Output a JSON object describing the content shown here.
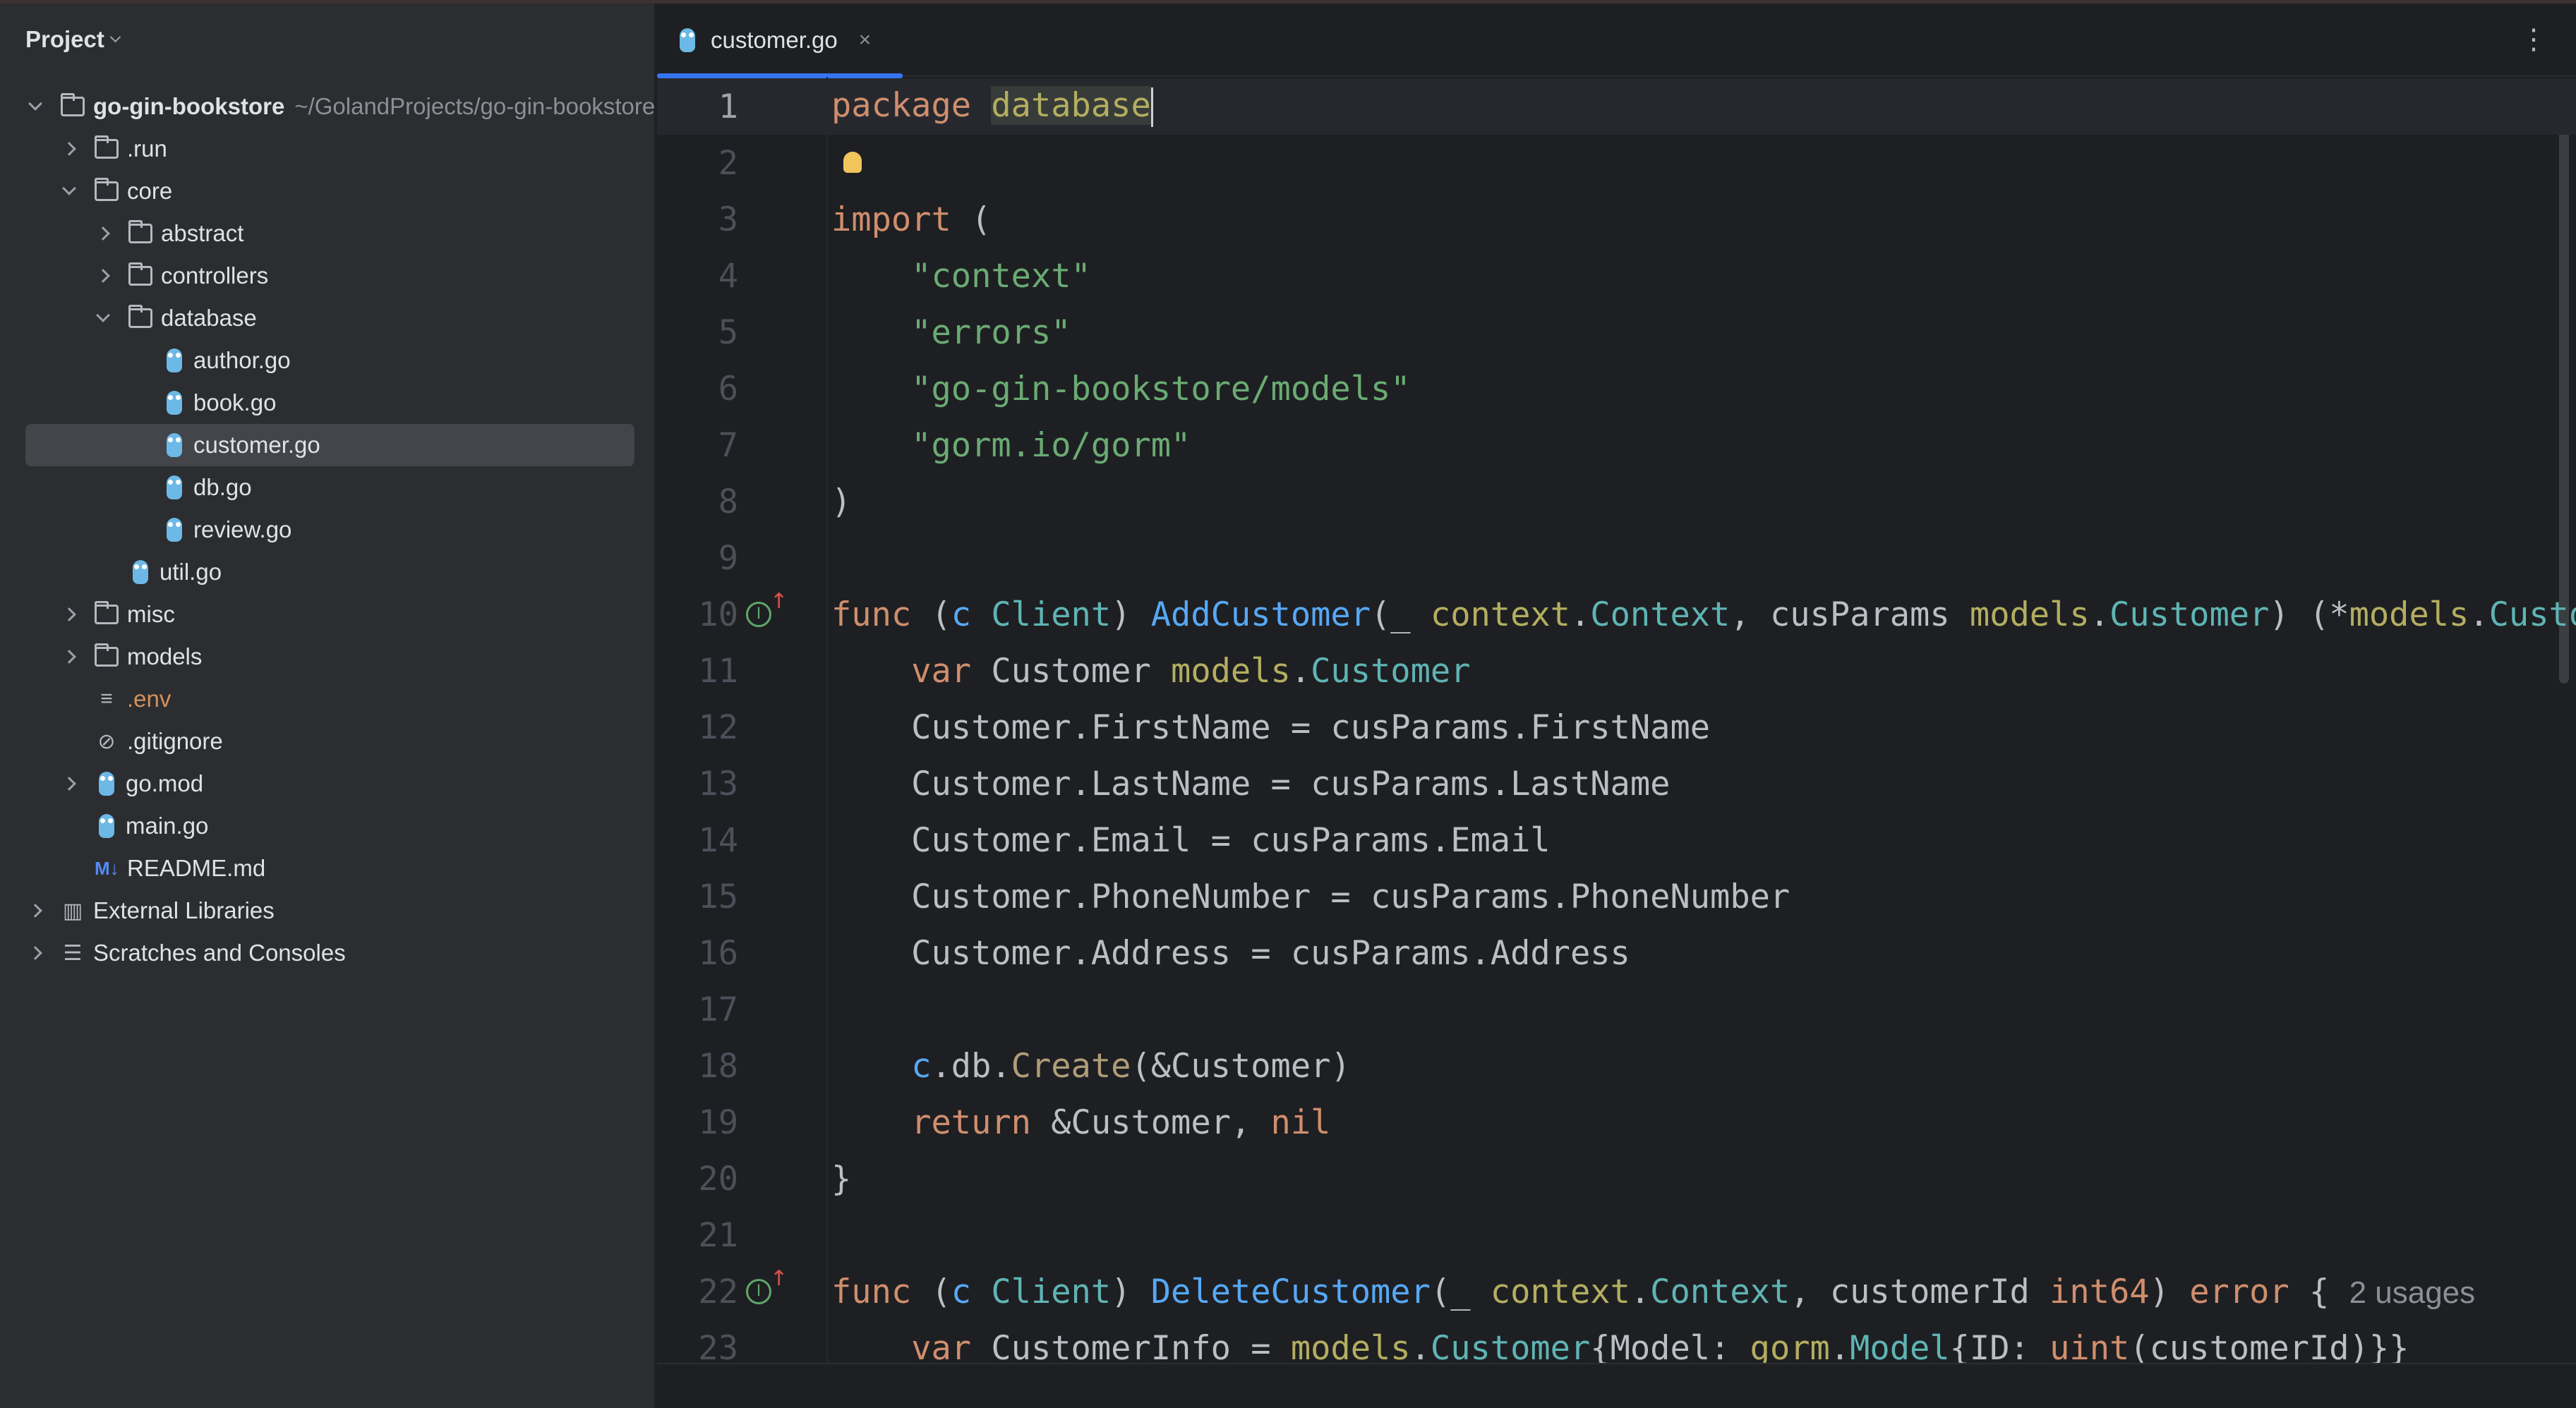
{
  "sidebar": {
    "title": "Project",
    "tree": [
      {
        "label": "go-gin-bookstore",
        "path": "~/GolandProjects/go-gin-bookstore",
        "level": 0,
        "icon": "folder-icon",
        "state": "open",
        "bold": true
      },
      {
        "label": ".run",
        "level": 1,
        "icon": "folder-icon",
        "state": "closed"
      },
      {
        "label": "core",
        "level": 1,
        "icon": "folder-icon",
        "state": "open"
      },
      {
        "label": "abstract",
        "level": 2,
        "icon": "folder-icon",
        "state": "closed"
      },
      {
        "label": "controllers",
        "level": 2,
        "icon": "folder-icon",
        "state": "closed"
      },
      {
        "label": "database",
        "level": 2,
        "icon": "folder-icon",
        "state": "open"
      },
      {
        "label": "author.go",
        "level": 3,
        "icon": "gopher-icon"
      },
      {
        "label": "book.go",
        "level": 3,
        "icon": "gopher-icon"
      },
      {
        "label": "customer.go",
        "level": 3,
        "icon": "gopher-icon",
        "selected": true
      },
      {
        "label": "db.go",
        "level": 3,
        "icon": "gopher-icon"
      },
      {
        "label": "review.go",
        "level": 3,
        "icon": "gopher-icon"
      },
      {
        "label": "util.go",
        "level": 2,
        "icon": "gopher-icon"
      },
      {
        "label": "misc",
        "level": 1,
        "icon": "folder-icon",
        "state": "closed"
      },
      {
        "label": "models",
        "level": 1,
        "icon": "folder-icon",
        "state": "closed"
      },
      {
        "label": ".env",
        "level": 1,
        "icon": "text-file-icon",
        "color": "#d5915b"
      },
      {
        "label": ".gitignore",
        "level": 1,
        "icon": "ignore-file-icon"
      },
      {
        "label": "go.mod",
        "level": 1,
        "icon": "gomod-icon",
        "state": "closed"
      },
      {
        "label": "main.go",
        "level": 1,
        "icon": "gopher-icon"
      },
      {
        "label": "README.md",
        "level": 1,
        "icon": "markdown-icon",
        "icon_text": "M↓"
      },
      {
        "label": "External Libraries",
        "level": 0,
        "icon": "library-icon",
        "state": "closed"
      },
      {
        "label": "Scratches and Consoles",
        "level": 0,
        "icon": "scratches-icon",
        "state": "closed"
      }
    ]
  },
  "tab": {
    "label": "customer.go",
    "close": "×",
    "more": "⋮"
  },
  "editor": {
    "check": "✓",
    "inlay_usages": "2 usages",
    "lines": [
      [
        [
          "package ",
          "k"
        ],
        [
          "database",
          "p hl"
        ]
      ],
      [],
      [
        [
          "import ",
          "k"
        ],
        [
          "(",
          "n"
        ]
      ],
      [
        [
          "    ",
          "n"
        ],
        [
          "\"context\"",
          "s"
        ]
      ],
      [
        [
          "    ",
          "n"
        ],
        [
          "\"errors\"",
          "s"
        ]
      ],
      [
        [
          "    ",
          "n"
        ],
        [
          "\"go-gin-bookstore/models\"",
          "s"
        ]
      ],
      [
        [
          "    ",
          "n"
        ],
        [
          "\"gorm.io/gorm\"",
          "s"
        ]
      ],
      [
        [
          ")",
          "n"
        ]
      ],
      [],
      [
        [
          "func ",
          "k"
        ],
        [
          "(",
          "n"
        ],
        [
          "c ",
          "r"
        ],
        [
          "Client",
          "t"
        ],
        [
          ") ",
          "n"
        ],
        [
          "AddCustomer",
          "f"
        ],
        [
          "(_ ",
          "n"
        ],
        [
          "context",
          "p"
        ],
        [
          ".",
          "n"
        ],
        [
          "Context",
          "t"
        ],
        [
          ", cusParams ",
          "n"
        ],
        [
          "models",
          "p"
        ],
        [
          ".",
          "n"
        ],
        [
          "Customer",
          "t"
        ],
        [
          ") (*",
          "n"
        ],
        [
          "models",
          "p"
        ],
        [
          ".",
          "n"
        ],
        [
          "Customer",
          "t"
        ]
      ],
      [
        [
          "    ",
          "n"
        ],
        [
          "var ",
          "k"
        ],
        [
          "Customer ",
          "n"
        ],
        [
          "models",
          "p"
        ],
        [
          ".",
          "n"
        ],
        [
          "Customer",
          "t"
        ]
      ],
      [
        [
          "    Customer.FirstName = cusParams.FirstName",
          "n"
        ]
      ],
      [
        [
          "    Customer.LastName = cusParams.LastName",
          "n"
        ]
      ],
      [
        [
          "    Customer.Email = cusParams.Email",
          "n"
        ]
      ],
      [
        [
          "    Customer.PhoneNumber = cusParams.PhoneNumber",
          "n"
        ]
      ],
      [
        [
          "    Customer.Address = cusParams.Address",
          "n"
        ]
      ],
      [],
      [
        [
          "    ",
          "n"
        ],
        [
          "c",
          "r"
        ],
        [
          ".db.",
          "n"
        ],
        [
          "Create",
          "m"
        ],
        [
          "(&Customer)",
          "n"
        ]
      ],
      [
        [
          "    ",
          "n"
        ],
        [
          "return ",
          "k"
        ],
        [
          "&Customer, ",
          "n"
        ],
        [
          "nil",
          "k"
        ]
      ],
      [
        [
          "}",
          "n"
        ]
      ],
      [],
      [
        [
          "func ",
          "k"
        ],
        [
          "(",
          "n"
        ],
        [
          "c ",
          "r"
        ],
        [
          "Client",
          "t"
        ],
        [
          ") ",
          "n"
        ],
        [
          "DeleteCustomer",
          "f"
        ],
        [
          "(_ ",
          "n"
        ],
        [
          "context",
          "p"
        ],
        [
          ".",
          "n"
        ],
        [
          "Context",
          "t"
        ],
        [
          ", customerId ",
          "n"
        ],
        [
          "int64",
          "k"
        ],
        [
          ") ",
          "n"
        ],
        [
          "error ",
          "k"
        ],
        [
          "{ ",
          "n"
        ],
        [
          "2 usages",
          "h"
        ]
      ],
      [
        [
          "    ",
          "n"
        ],
        [
          "var ",
          "k"
        ],
        [
          "CustomerInfo = ",
          "n"
        ],
        [
          "models",
          "p"
        ],
        [
          ".",
          "n"
        ],
        [
          "Customer",
          "t"
        ],
        [
          "{Model: ",
          "n"
        ],
        [
          "gorm",
          "p"
        ],
        [
          ".",
          "n"
        ],
        [
          "Model",
          "t"
        ],
        [
          "{ID: ",
          "n"
        ],
        [
          "uint",
          "k"
        ],
        [
          "(customerId)}}",
          "n"
        ]
      ]
    ]
  }
}
